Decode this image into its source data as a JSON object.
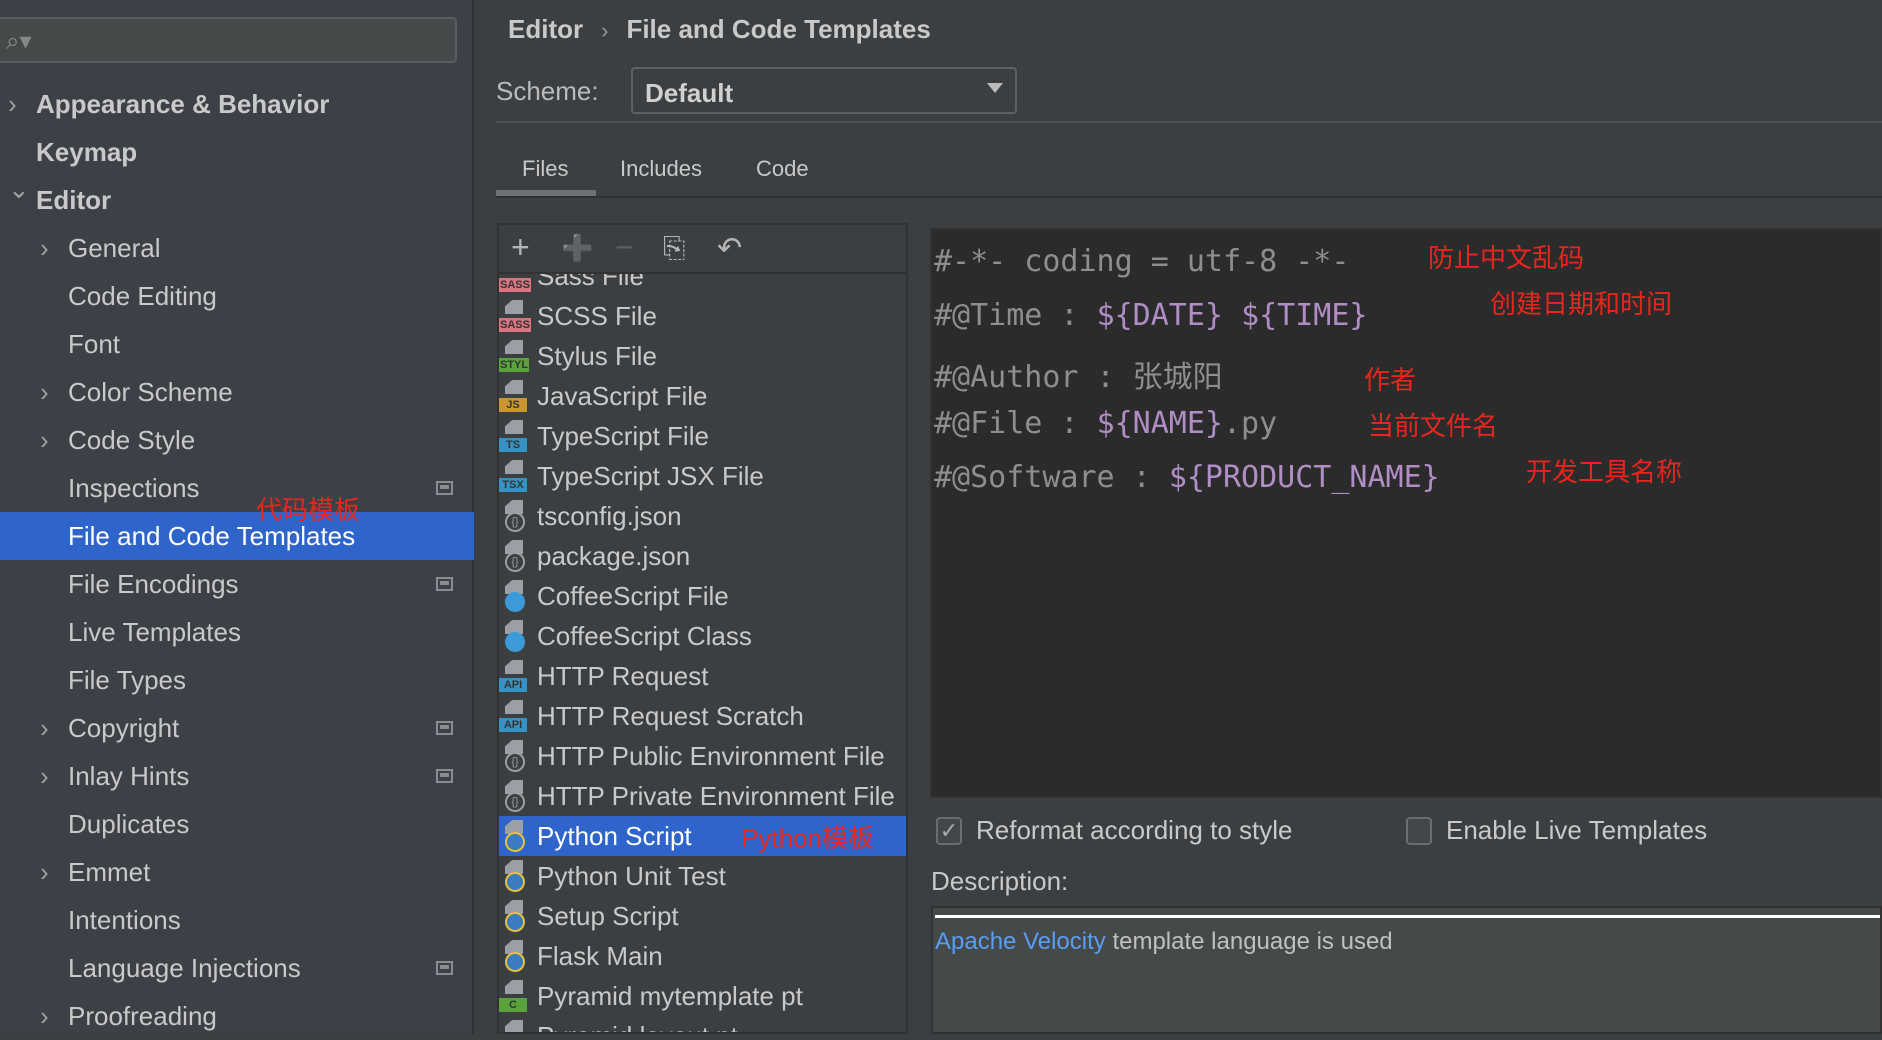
{
  "sidebar": {
    "search_placeholder": "",
    "items": [
      {
        "label": "Appearance & Behavior",
        "level": 0,
        "chevron": "right",
        "bold": true
      },
      {
        "label": "Keymap",
        "level": 0,
        "chevron": "",
        "bold": true
      },
      {
        "label": "Editor",
        "level": 0,
        "chevron": "down",
        "bold": true
      },
      {
        "label": "General",
        "level": 1,
        "chevron": "right"
      },
      {
        "label": "Code Editing",
        "level": 1,
        "chevron": ""
      },
      {
        "label": "Font",
        "level": 1,
        "chevron": ""
      },
      {
        "label": "Color Scheme",
        "level": 1,
        "chevron": "right"
      },
      {
        "label": "Code Style",
        "level": 1,
        "chevron": "right"
      },
      {
        "label": "Inspections",
        "level": 1,
        "chevron": "",
        "project": true
      },
      {
        "label": "File and Code Templates",
        "level": 1,
        "chevron": "",
        "selected": true
      },
      {
        "label": "File Encodings",
        "level": 1,
        "chevron": "",
        "project": true
      },
      {
        "label": "Live Templates",
        "level": 1,
        "chevron": ""
      },
      {
        "label": "File Types",
        "level": 1,
        "chevron": ""
      },
      {
        "label": "Copyright",
        "level": 1,
        "chevron": "right",
        "project": true
      },
      {
        "label": "Inlay Hints",
        "level": 1,
        "chevron": "right",
        "project": true
      },
      {
        "label": "Duplicates",
        "level": 1,
        "chevron": ""
      },
      {
        "label": "Emmet",
        "level": 1,
        "chevron": "right"
      },
      {
        "label": "Intentions",
        "level": 1,
        "chevron": ""
      },
      {
        "label": "Language Injections",
        "level": 1,
        "chevron": "",
        "project": true
      },
      {
        "label": "Proofreading",
        "level": 1,
        "chevron": "right"
      }
    ],
    "annotation": "代码模板"
  },
  "breadcrumb": {
    "parent": "Editor",
    "current": "File and Code Templates"
  },
  "scheme": {
    "label": "Scheme:",
    "value": "Default"
  },
  "tabs": [
    {
      "label": "Files",
      "active": true
    },
    {
      "label": "Includes"
    },
    {
      "label": "Code"
    }
  ],
  "toolbar": {
    "icons": [
      "plus-icon",
      "add-child-icon",
      "minus-icon",
      "copy-icon",
      "reset-icon"
    ]
  },
  "templates": [
    {
      "label": "Sass File",
      "badge": "SASS",
      "color": "#d9737f"
    },
    {
      "label": "SCSS File",
      "badge": "SASS",
      "color": "#d9737f"
    },
    {
      "label": "Stylus File",
      "badge": "STYL",
      "color": "#59a33a"
    },
    {
      "label": "JavaScript File",
      "badge": "JS",
      "color": "#c9962f"
    },
    {
      "label": "TypeScript File",
      "badge": "TS",
      "color": "#3592c4"
    },
    {
      "label": "TypeScript JSX File",
      "badge": "TSX",
      "color": "#3592c4"
    },
    {
      "label": "tsconfig.json",
      "badge": "{}"
    },
    {
      "label": "package.json",
      "badge": "{}"
    },
    {
      "label": "CoffeeScript File",
      "badge": "coffee",
      "color": "#3d9ad9"
    },
    {
      "label": "CoffeeScript Class",
      "badge": "coffee",
      "color": "#3d9ad9"
    },
    {
      "label": "HTTP Request",
      "badge": "API",
      "color": "#3592c4"
    },
    {
      "label": "HTTP Request Scratch",
      "badge": "API",
      "color": "#3592c4"
    },
    {
      "label": "HTTP Public Environment File",
      "badge": "{}"
    },
    {
      "label": "HTTP Private Environment File",
      "badge": "{}"
    },
    {
      "label": "Python Script",
      "badge": "py",
      "color": "#3b7bbf",
      "selected": true
    },
    {
      "label": "Python Unit Test",
      "badge": "py",
      "color": "#3b7bbf"
    },
    {
      "label": "Setup Script",
      "badge": "py",
      "color": "#3b7bbf"
    },
    {
      "label": "Flask Main",
      "badge": "py",
      "color": "#3b7bbf"
    },
    {
      "label": "Pyramid mytemplate pt",
      "badge": "C",
      "color": "#59a33a"
    },
    {
      "label": "Pyramid layout pt",
      "badge": "C",
      "color": "#59a33a"
    }
  ],
  "template_annotation": "Python模板",
  "editor": {
    "lines": [
      {
        "parts": [
          {
            "t": "#-*- coding = utf-8 -*-"
          }
        ],
        "note": "防止中文乱码"
      },
      {
        "parts": [
          {
            "t": "#@Time : "
          },
          {
            "t": "${DATE}",
            "v": true
          },
          {
            "t": " "
          },
          {
            "t": "${TIME}",
            "v": true
          }
        ],
        "note": "创建日期和时间"
      },
      {
        "parts": [
          {
            "t": "#@Author : 张城阳"
          }
        ],
        "note": "作者"
      },
      {
        "parts": [
          {
            "t": "#@File : "
          },
          {
            "t": "${NAME}",
            "v": true
          },
          {
            "t": ".py"
          }
        ],
        "note": "当前文件名"
      },
      {
        "parts": [
          {
            "t": "#@Software : "
          },
          {
            "t": "${PRODUCT_NAME}",
            "v": true
          }
        ],
        "note": "开发工具名称"
      }
    ]
  },
  "options": {
    "reformat": {
      "label": "Reformat according to style",
      "checked": true
    },
    "live_templates": {
      "label": "Enable Live Templates",
      "checked": false
    }
  },
  "description": {
    "label": "Description:",
    "link": "Apache Velocity",
    "text": " template language is used"
  },
  "colors": {
    "accent": "#2f65ca",
    "annotation": "#e8261d",
    "variable": "#b08dc5",
    "link": "#589df6"
  }
}
